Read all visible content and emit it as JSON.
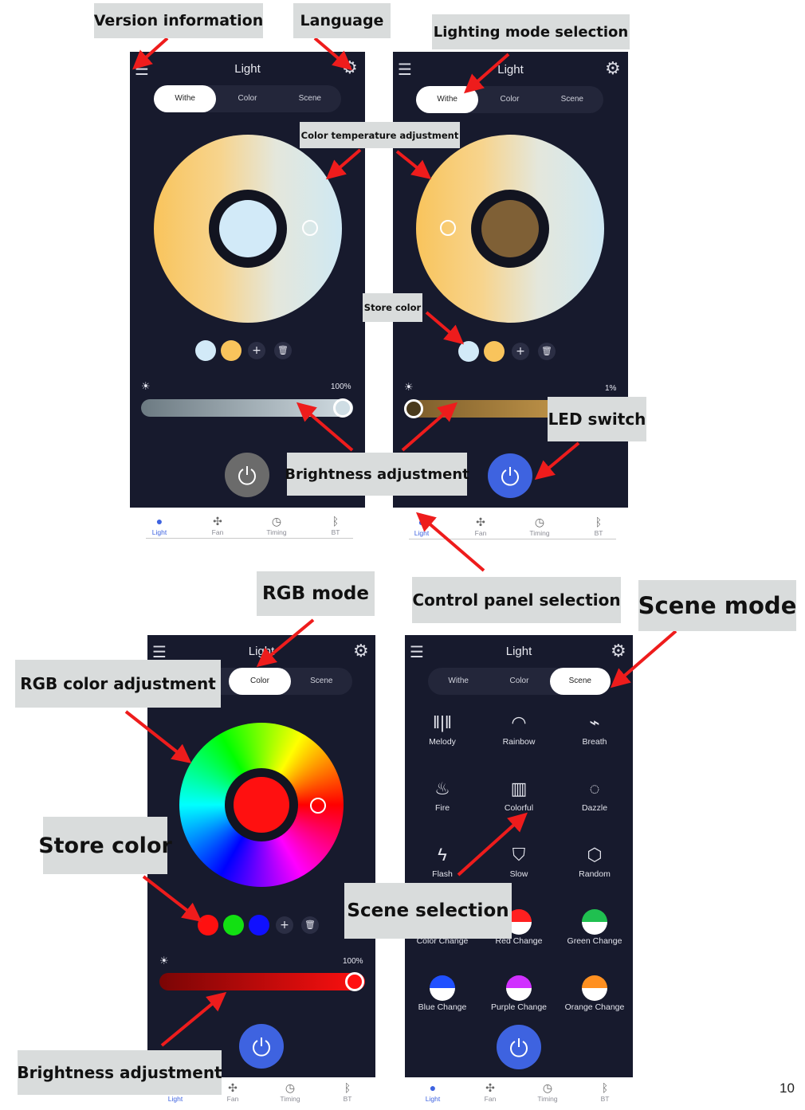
{
  "page_number": "10",
  "screens": {
    "title": "Light",
    "tabs": [
      "Withe",
      "Color",
      "Scene"
    ],
    "nav": [
      "Light",
      "Fan",
      "Timing",
      "BT"
    ],
    "plus": "+",
    "trash": "🗑"
  },
  "screen1": {
    "brightness": "100%",
    "power_state": "off"
  },
  "screen2": {
    "brightness": "1%",
    "power_state": "on"
  },
  "screen3": {
    "brightness": "100%"
  },
  "scenes": [
    {
      "label": "Melody",
      "icon": "melody-icon"
    },
    {
      "label": "Rainbow",
      "icon": "rainbow-icon"
    },
    {
      "label": "Breath",
      "icon": "breath-icon"
    },
    {
      "label": "Fire",
      "icon": "fire-icon"
    },
    {
      "label": "Colorful",
      "icon": "colorful-icon"
    },
    {
      "label": "Dazzle",
      "icon": "dazzle-icon"
    },
    {
      "label": "Flash",
      "icon": "flash-icon"
    },
    {
      "label": "Slow",
      "icon": "slow-icon"
    },
    {
      "label": "Random",
      "icon": "random-icon"
    },
    {
      "label": "Color Change",
      "icon": "color-change-icon"
    },
    {
      "label": "Red Change",
      "icon": "red-change-icon"
    },
    {
      "label": "Green Change",
      "icon": "green-change-icon"
    },
    {
      "label": "Blue Change",
      "icon": "blue-change-icon"
    },
    {
      "label": "Purple Change",
      "icon": "purple-change-icon"
    },
    {
      "label": "Orange Change",
      "icon": "orange-change-icon"
    }
  ],
  "callouts": {
    "version_information": "Version information",
    "language": "Language",
    "lighting_mode_selection": "Lighting mode selection",
    "color_temperature_adjustment": "Color temperature adjustment",
    "store_color_small": "Store color",
    "led_switch": "LED switch",
    "brightness_adjustment_top": "Brightness adjustment",
    "control_panel_selection": "Control panel selection",
    "rgb_mode": "RGB mode",
    "scene_mode": "Scene mode",
    "rgb_color_adjustment": "RGB color adjustment",
    "store_color_large": "Store color",
    "scene_selection": "Scene selection",
    "brightness_adjustment_bottom": "Brightness adjustment"
  },
  "colors": {
    "app_background": "#171a2d",
    "accent_blue": "#3e63e0",
    "callout_background": "#d9dcdc",
    "arrow_red": "#ee1c1c"
  }
}
